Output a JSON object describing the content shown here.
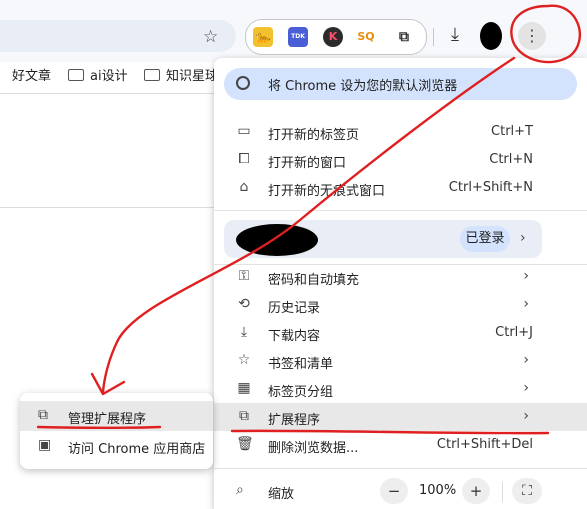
{
  "toolbar": {
    "bookmark_star": "☆",
    "extensions": [
      {
        "name": "extension-1",
        "glyph": "🐆"
      },
      {
        "name": "extension-tdk",
        "glyph": "TDK"
      },
      {
        "name": "extension-k",
        "glyph": "K"
      },
      {
        "name": "extension-sq",
        "glyph": "SQ"
      },
      {
        "name": "extensions-puzzle",
        "glyph": "⧉"
      }
    ],
    "download_icon": "⤓",
    "menu_icon": "⋮"
  },
  "bookmarks": [
    {
      "label": "好文章"
    },
    {
      "label": "ai设计"
    },
    {
      "label": "知识星球"
    }
  ],
  "menu": {
    "default_browser": {
      "label": "将 Chrome 设为您的默认浏览器",
      "icon": "chrome-icon"
    },
    "items_top": [
      {
        "label": "打开新的标签页",
        "shortcut": "Ctrl+T",
        "icon": "▭"
      },
      {
        "label": "打开新的窗口",
        "shortcut": "Ctrl+N",
        "icon": "⧠"
      },
      {
        "label": "打开新的无痕式窗口",
        "shortcut": "Ctrl+Shift+N",
        "icon": "⌂"
      }
    ],
    "profile": {
      "status": "已登录",
      "arrow": "›"
    },
    "items_mid": [
      {
        "label": "密码和自动填充",
        "shortcut": "›",
        "icon": "⚿"
      },
      {
        "label": "历史记录",
        "shortcut": "›",
        "icon": "⟲"
      },
      {
        "label": "下载内容",
        "shortcut": "Ctrl+J",
        "icon": "⤓"
      },
      {
        "label": "书签和清单",
        "shortcut": "›",
        "icon": "☆"
      },
      {
        "label": "标签页分组",
        "shortcut": "›",
        "icon": "▦"
      },
      {
        "label": "扩展程序",
        "shortcut": "›",
        "icon": "⧉"
      },
      {
        "label": "删除浏览数据...",
        "shortcut": "Ctrl+Shift+Del",
        "icon": "🗑"
      }
    ],
    "zoom": {
      "label": "缩放",
      "minus": "−",
      "value": "100%",
      "plus": "+",
      "fullscreen": "⛶",
      "icon": "⌕"
    }
  },
  "submenu": {
    "items": [
      {
        "label": "管理扩展程序",
        "icon": "⧉"
      },
      {
        "label": "访问 Chrome 应用商店",
        "icon": "▣"
      }
    ]
  },
  "colors": {
    "annotation_red": "#e02020",
    "highlight_blue": "#d3e3fd"
  }
}
